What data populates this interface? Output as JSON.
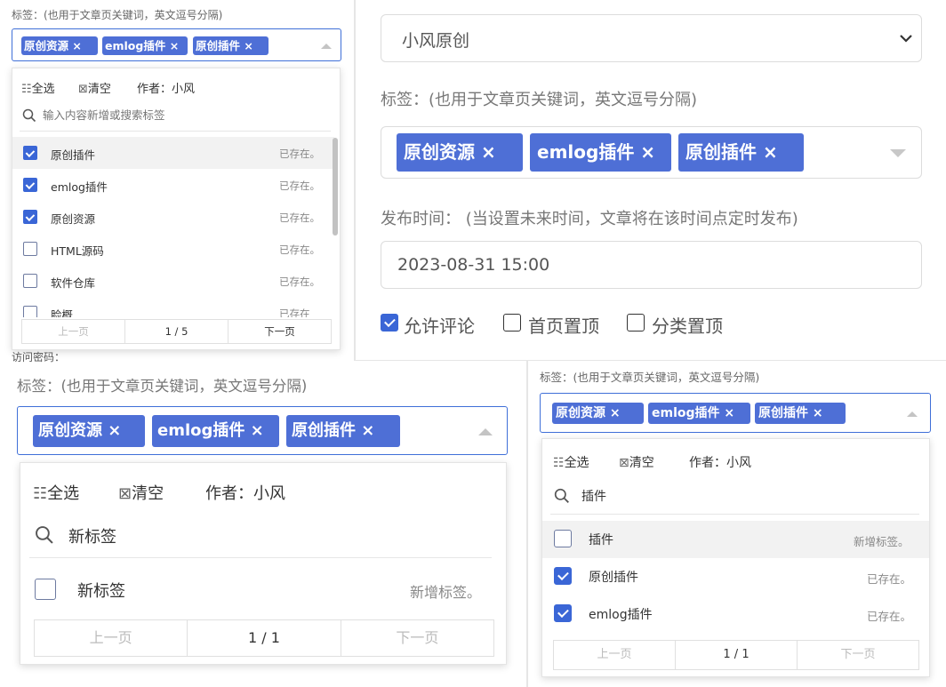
{
  "tag_label": "标签：(也用于文章页关键词，英文逗号分隔)",
  "tags": [
    "原创资源",
    "emlog插件",
    "原创插件"
  ],
  "remove_glyph": "×",
  "toolbar": {
    "select_all": "全选",
    "clear": "清空",
    "author": "作者：小风"
  },
  "panel1": {
    "placeholder": "输入内容新增或搜索标签",
    "items": [
      {
        "label": "原创插件",
        "status": "已存在。",
        "checked": true
      },
      {
        "label": "emlog插件",
        "status": "已存在。",
        "checked": true
      },
      {
        "label": "原创资源",
        "status": "已存在。",
        "checked": true
      },
      {
        "label": "HTML源码",
        "status": "已存在。",
        "checked": false
      },
      {
        "label": "软件仓库",
        "status": "已存在。",
        "checked": false
      },
      {
        "label": "脸概",
        "status": "已存在",
        "checked": false
      }
    ],
    "pager": {
      "prev": "上一页",
      "page": "1 / 5",
      "next": "下一页"
    },
    "below_text": "访问密码："
  },
  "panel2": {
    "author_select": "小风原创",
    "tag_label": "标签：(也用于文章页关键词，英文逗号分隔)",
    "publish_label": "发布时间：",
    "publish_hint": "(当设置未来时间，文章将在该时间点定时发布)",
    "publish_value": "2023-08-31 15:00",
    "options": [
      {
        "label": "允许评论",
        "checked": true
      },
      {
        "label": "首页置顶",
        "checked": false
      },
      {
        "label": "分类置顶",
        "checked": false
      }
    ]
  },
  "panel3": {
    "search_value": "新标签",
    "items": [
      {
        "label": "新标签",
        "status": "新增标签。",
        "checked": false
      }
    ],
    "pager": {
      "prev": "上一页",
      "page": "1 / 1",
      "next": "下一页"
    }
  },
  "panel4": {
    "search_value": "插件",
    "items": [
      {
        "label": "插件",
        "status": "新增标签。",
        "checked": false
      },
      {
        "label": "原创插件",
        "status": "已存在。",
        "checked": true
      },
      {
        "label": "emlog插件",
        "status": "已存在。",
        "checked": true
      }
    ],
    "pager": {
      "prev": "上一页",
      "page": "1 / 1",
      "next": "下一页"
    }
  },
  "colors": {
    "tag_bg": "#4e6fd6",
    "accent": "#3a66d6",
    "border": "#3f6fd8"
  }
}
